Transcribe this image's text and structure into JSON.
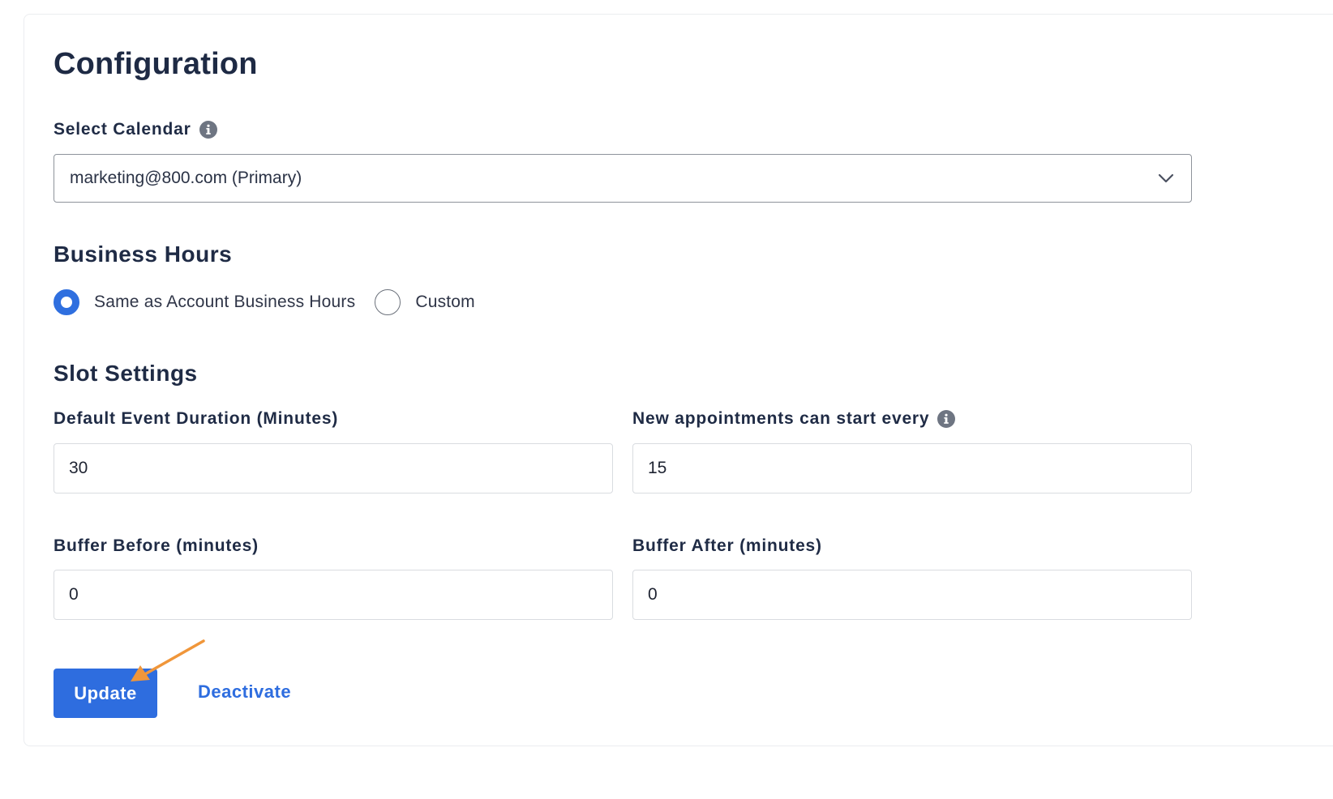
{
  "page": {
    "title": "Configuration"
  },
  "calendar": {
    "label": "Select Calendar",
    "selected": "marketing@800.com (Primary)"
  },
  "business_hours": {
    "title": "Business Hours",
    "options": [
      {
        "label": "Same as Account Business Hours",
        "checked": true
      },
      {
        "label": "Custom",
        "checked": false
      }
    ]
  },
  "slot_settings": {
    "title": "Slot Settings",
    "default_duration": {
      "label": "Default Event Duration (Minutes)",
      "value": "30"
    },
    "start_every": {
      "label": "New appointments can start every",
      "value": "15"
    },
    "buffer_before": {
      "label": "Buffer Before (minutes)",
      "value": "0"
    },
    "buffer_after": {
      "label": "Buffer After (minutes)",
      "value": "0"
    }
  },
  "actions": {
    "update_label": "Update",
    "deactivate_label": "Deactivate"
  },
  "colors": {
    "primary": "#2e6ddf",
    "annotation_arrow": "#f0963a",
    "heading_text": "#1e2a44"
  },
  "icons": {
    "info": "info-circle-icon",
    "dropdown": "chevron-down-icon",
    "annotation": "arrow-annotation-icon"
  }
}
